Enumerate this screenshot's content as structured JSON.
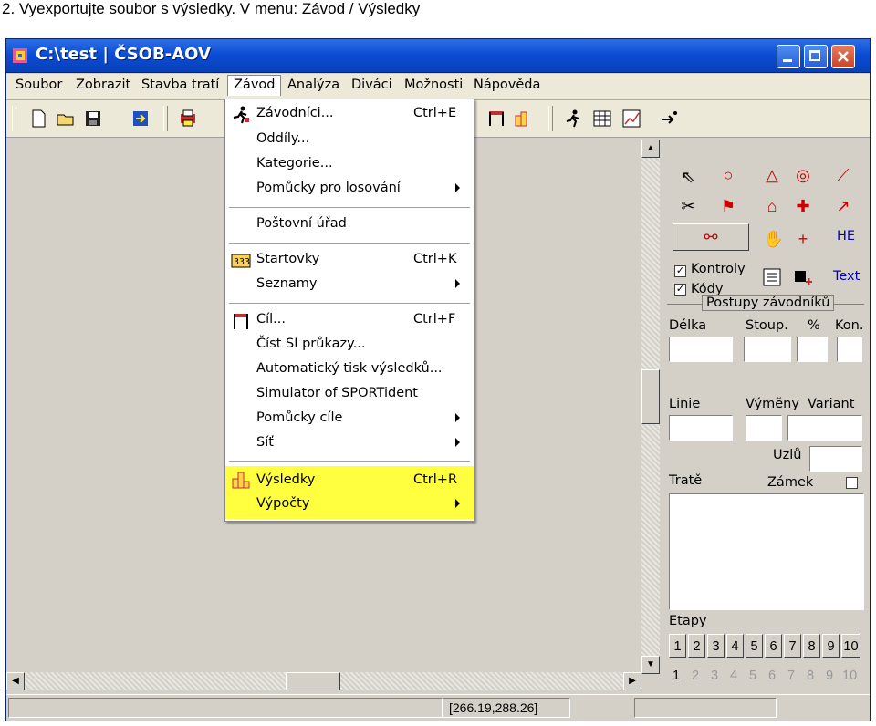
{
  "caption": "2. Vyexportujte soubor s výsledky. V menu: Závod / Výsledky",
  "window": {
    "title": "C:\\test | ČSOB-AOV"
  },
  "menubar": [
    {
      "label": "Soubor"
    },
    {
      "label": "Zobrazit"
    },
    {
      "label": "Stavba tratí"
    },
    {
      "label": "Závod"
    },
    {
      "label": "Analýza"
    },
    {
      "label": "Diváci"
    },
    {
      "label": "Možnosti"
    },
    {
      "label": "Nápověda"
    }
  ],
  "dropdown": {
    "items": [
      {
        "label": "Závodníci...",
        "shortcut": "Ctrl+E",
        "icon": "runner-icon"
      },
      {
        "label": "Oddíly...",
        "shortcut": ""
      },
      {
        "label": "Kategorie...",
        "shortcut": ""
      },
      {
        "label": "Pomůcky pro losování",
        "shortcut": "",
        "submenu": true
      },
      {
        "label": "Poštovní úřad",
        "shortcut": ""
      },
      {
        "label": "Startovky",
        "shortcut": "Ctrl+K",
        "icon": "startlist-icon"
      },
      {
        "label": "Seznamy",
        "shortcut": "",
        "submenu": true
      },
      {
        "label": "Cíl...",
        "shortcut": "Ctrl+F",
        "icon": "finish-icon"
      },
      {
        "label": "Číst SI průkazy...",
        "shortcut": ""
      },
      {
        "label": "Automatický tisk výsledků...",
        "shortcut": ""
      },
      {
        "label": "Simulator of SPORTident",
        "shortcut": ""
      },
      {
        "label": "Pomůcky cíle",
        "shortcut": "",
        "submenu": true
      },
      {
        "label": "Síť",
        "shortcut": "",
        "submenu": true
      },
      {
        "label": "Výsledky",
        "shortcut": "Ctrl+R",
        "icon": "results-icon",
        "highlighted": true
      },
      {
        "label": "Výpočty",
        "shortcut": "",
        "submenu": true
      }
    ],
    "highlight_color": "#ffff40"
  },
  "right_panel": {
    "tools_text": "HE",
    "text_tool": "Text",
    "kontroly": "Kontroly",
    "kody": "Kódy",
    "group_title": "Postupy závodníků",
    "delka": "Délka",
    "stoup": "Stoup.",
    "pct": "%",
    "kon": "Kon.",
    "linie": "Linie",
    "vymeny": "Výměny",
    "variant": "Variant",
    "uzlu": "Uzlů",
    "trate": "Tratě",
    "zamek": "Zámek",
    "etapy": "Etapy",
    "etapy_tabs": [
      "1",
      "2",
      "3",
      "4",
      "5",
      "6",
      "7",
      "8",
      "9",
      "10"
    ],
    "etapy_row2": [
      "1",
      "2",
      "3",
      "4",
      "5",
      "6",
      "7",
      "8",
      "9",
      "10"
    ]
  },
  "statusbar": {
    "coords": "[266.19,288.26]"
  },
  "colors": {
    "titlebar": "#0a4bd4",
    "dialog_bg": "#d4d0c8",
    "accent_red": "#cc0000"
  }
}
